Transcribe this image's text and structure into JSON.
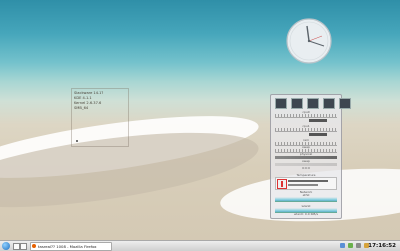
{
  "sysinfo": {
    "lines": [
      "Slackware 14.1?",
      "KDE 4.1.1",
      "Kernel 2.6.37.6",
      "SMB_64"
    ]
  },
  "clock": {
    "face_color": "#e9eef1"
  },
  "monitor": {
    "labels": [
      "cpu0",
      "cpu1",
      "ram",
      "swap",
      "physical",
      "swap",
      "ACPI",
      "Temperature",
      "Network",
      "eth0",
      "wlan0"
    ],
    "temp_readouts": [
      "",
      "",
      ""
    ],
    "readouts": [
      "0:0:0",
      "wlan0: 0.0 KiB/s"
    ]
  },
  "taskbar": {
    "task_title": "tasreal?? 1008 - Mozilla Firefox",
    "clock": "17:16:52"
  },
  "icons": {
    "launcher": "kde-kicker-icon",
    "firefox": "firefox-icon",
    "thermometer": "thermometer-icon"
  }
}
